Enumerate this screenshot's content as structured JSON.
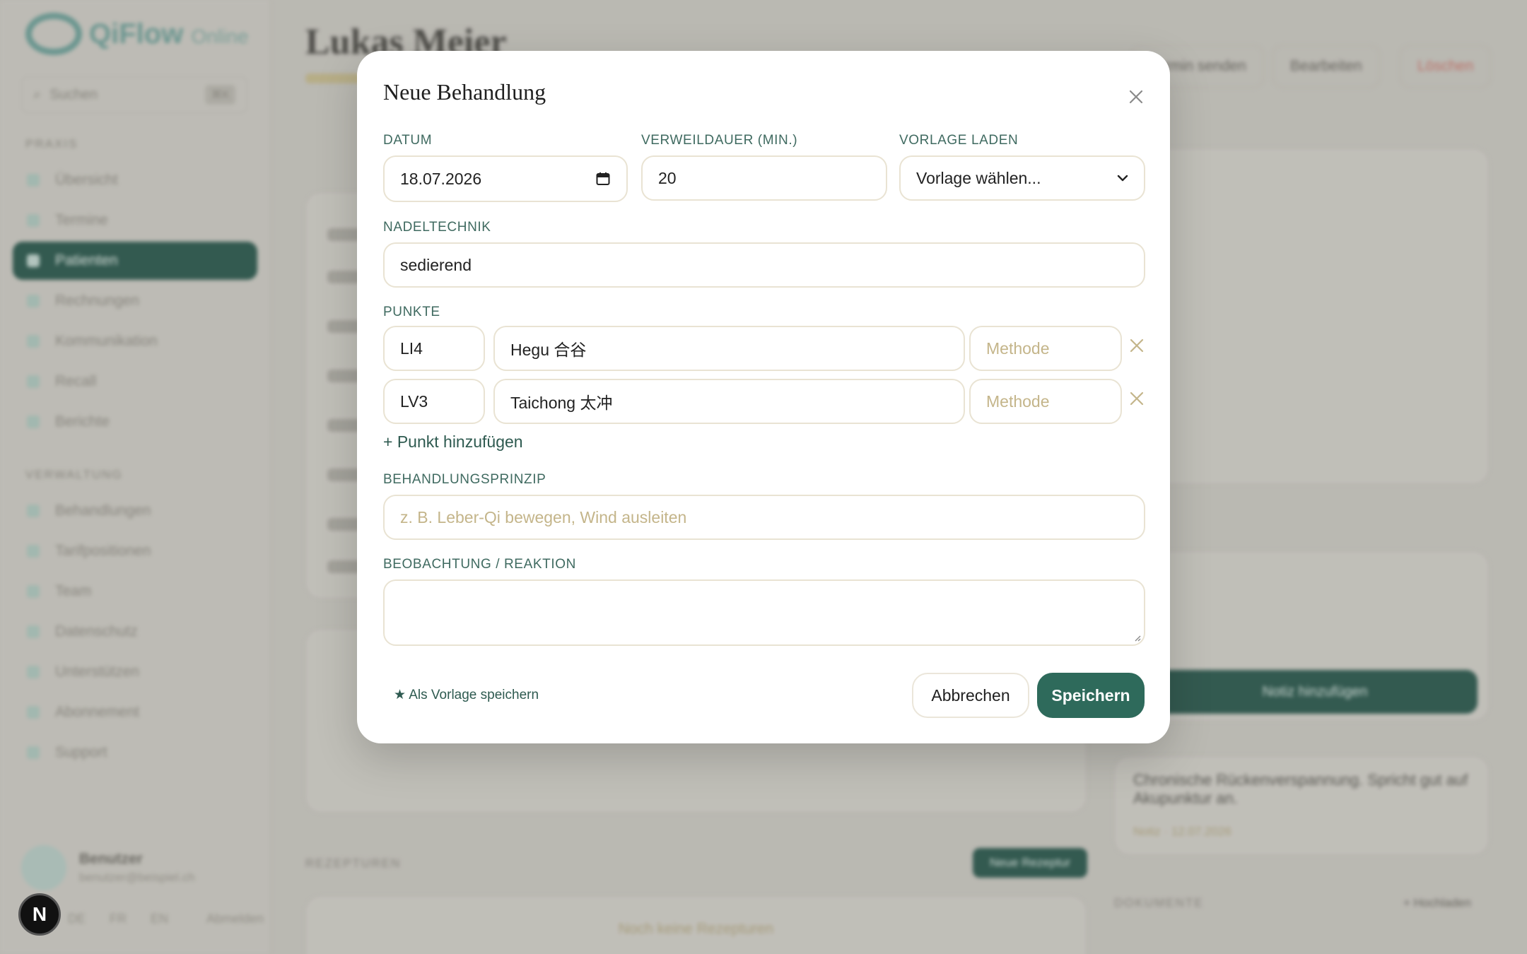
{
  "colors": {
    "primary": "#2e6a5b",
    "label": "#3f6a60",
    "field_border": "#e9e3d3",
    "placeholder": "#c4b58a",
    "remove_icon": "#c4b58a"
  },
  "background": {
    "brand": {
      "name": "QiFlow",
      "suffix": "Online"
    },
    "search_placeholder": "Suchen",
    "search_shortcut": "⌘K",
    "section_practice": "PRAXIS",
    "nav_practice": [
      "Übersicht",
      "Termine",
      "Patienten",
      "Rechnungen",
      "Kommunikation",
      "Recall",
      "Berichte"
    ],
    "active_item": "Patienten",
    "section_admin": "VERWALTUNG",
    "nav_admin": [
      "Behandlungen",
      "Tarifpositionen",
      "Team",
      "Datenschutz",
      "Unterstützen",
      "Abonnement",
      "Support"
    ],
    "profile": {
      "name": "Benutzer",
      "email": "benutzer@beispiel.ch"
    },
    "languages": [
      "DE",
      "FR",
      "EN"
    ],
    "language_action": "Abmelden",
    "n_badge": "N",
    "patient_name": "Lukas Meier",
    "header_buttons": [
      "Termin senden",
      "Bearbeiten",
      "Löschen"
    ],
    "notes_card_text": "Chronische Rückenverspannung. Spricht gut auf Akupunktur an.",
    "notes_card_meta": "Notiz · 12.07.2026",
    "card_button": "Notiz hinzufügen",
    "section_prescriptions": "REZEPTUREN",
    "new_prescription": "Neue Rezeptur",
    "no_prescriptions": "Noch keine Rezepturen",
    "section_documents": "DOKUMENTE",
    "add_document": "+ Hochladen"
  },
  "modal": {
    "title": "Neue Behandlung",
    "close_icon": "close-icon",
    "date": {
      "label": "DATUM",
      "value": "18.07.2026",
      "icon": "calendar-icon"
    },
    "duration": {
      "label": "VERWEILDAUER (MIN.)",
      "value": "20"
    },
    "template": {
      "label": "VORLAGE LADEN",
      "value": "Vorlage wählen...",
      "icon": "chevron-down-icon"
    },
    "needle_technique": {
      "label": "NADELTECHNIK",
      "value": "sedierend"
    },
    "points": {
      "label": "PUNKTE",
      "rows": [
        {
          "code": "LI4",
          "name": "Hegu 合谷",
          "method_placeholder": "Methode"
        },
        {
          "code": "LV3",
          "name": "Taichong 太冲",
          "method_placeholder": "Methode"
        }
      ],
      "add_label": "+ Punkt hinzufügen"
    },
    "principle": {
      "label": "BEHANDLUNGSPRINZIP",
      "placeholder": "z. B. Leber-Qi bewegen, Wind ausleiten"
    },
    "observation": {
      "label": "BEOBACHTUNG / REAKTION",
      "value": ""
    },
    "save_template": "★ Als Vorlage speichern",
    "cancel": "Abbrechen",
    "save": "Speichern"
  }
}
